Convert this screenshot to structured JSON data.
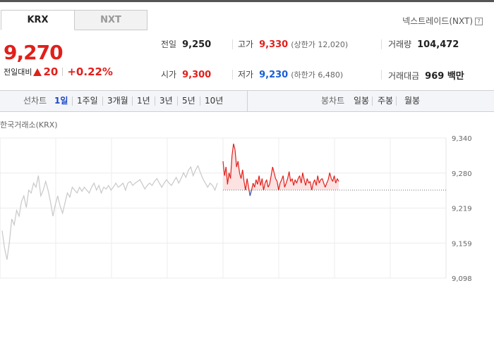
{
  "tabs": [
    {
      "label": "KRX",
      "active": true
    },
    {
      "label": "NXT",
      "active": false
    }
  ],
  "nxt_link": "넥스트레이드(NXT)",
  "price": {
    "current": "9,270",
    "change_label": "전일대비",
    "change_amount": "20",
    "change_percent": "+0.22%",
    "direction": "up"
  },
  "stats": {
    "prev_close": {
      "label": "전일",
      "value": "9,250"
    },
    "high": {
      "label": "고가",
      "value": "9,330",
      "sub": "(상한가 12,020)"
    },
    "volume": {
      "label": "거래량",
      "value": "104,472"
    },
    "open": {
      "label": "시가",
      "value": "9,300"
    },
    "low": {
      "label": "저가",
      "value": "9,230",
      "sub": "(하한가 6,480)"
    },
    "amount": {
      "label": "거래대금",
      "value": "969 백만"
    }
  },
  "chart_controls": {
    "line_label": "선차트",
    "line_periods": [
      "1일",
      "1주일",
      "3개월",
      "1년",
      "3년",
      "5년",
      "10년"
    ],
    "selected": "1일",
    "candle_label": "봉차트",
    "candle_periods": [
      "일봉",
      "주봉",
      "월봉"
    ]
  },
  "chart_data": {
    "type": "line",
    "exchange_label": "한국거래소(KRX)",
    "y_ticks": [
      "9,340",
      "9,280",
      "9,219",
      "9,159",
      "9,098"
    ],
    "ylim": [
      9098,
      9340
    ],
    "reference": 9250,
    "colors": {
      "up": "#e0201b",
      "down": "#1a5ed6",
      "previous": "#c8c8c8"
    },
    "previous_day": [
      9180,
      9150,
      9130,
      9160,
      9200,
      9190,
      9215,
      9205,
      9230,
      9240,
      9220,
      9250,
      9245,
      9262,
      9255,
      9275,
      9240,
      9250,
      9265,
      9250,
      9230,
      9205,
      9225,
      9240,
      9222,
      9210,
      9228,
      9245,
      9238,
      9255,
      9250,
      9245,
      9255,
      9248,
      9255,
      9250,
      9245,
      9255,
      9262,
      9250,
      9258,
      9245,
      9255,
      9252,
      9258,
      9250,
      9255,
      9262,
      9255,
      9258,
      9262,
      9250,
      9262,
      9265,
      9258,
      9262,
      9265,
      9268,
      9260,
      9252,
      9258,
      9262,
      9258,
      9265,
      9270,
      9262,
      9255,
      9262,
      9268,
      9262,
      9258,
      9265,
      9272,
      9262,
      9270,
      9280,
      9272,
      9284,
      9290,
      9275,
      9285,
      9292,
      9280,
      9270,
      9262,
      9255,
      9262,
      9258,
      9250,
      9262
    ],
    "today": [
      9300,
      9275,
      9290,
      9260,
      9280,
      9270,
      9310,
      9330,
      9320,
      9290,
      9300,
      9280,
      9270,
      9285,
      9265,
      9250,
      9270,
      9255,
      9240,
      9250,
      9262,
      9255,
      9268,
      9260,
      9275,
      9258,
      9270,
      9250,
      9262,
      9268,
      9255,
      9260,
      9275,
      9290,
      9280,
      9270,
      9265,
      9250,
      9262,
      9268,
      9275,
      9255,
      9262,
      9270,
      9282,
      9265,
      9270,
      9258,
      9268,
      9262,
      9270,
      9275,
      9262,
      9280,
      9268,
      9258,
      9270,
      9262,
      9265,
      9250,
      9262,
      9268,
      9258,
      9275,
      9262,
      9268,
      9270,
      9262,
      9255,
      9262,
      9268,
      9280,
      9270,
      9265,
      9275,
      9262,
      9270,
      9265
    ]
  }
}
